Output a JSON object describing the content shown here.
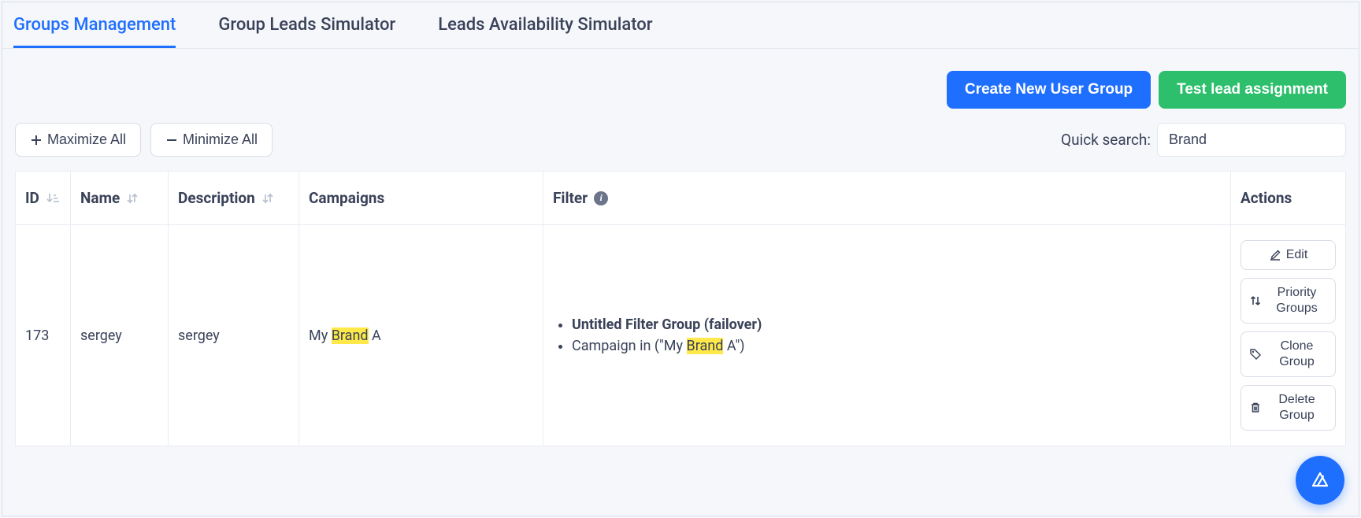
{
  "tabs": [
    {
      "label": "Groups Management",
      "active": true
    },
    {
      "label": "Group Leads Simulator",
      "active": false
    },
    {
      "label": "Leads Availability Simulator",
      "active": false
    }
  ],
  "buttons": {
    "create_group": "Create New User Group",
    "test_assignment": "Test lead assignment",
    "maximize_all": "Maximize All",
    "minimize_all": "Minimize All"
  },
  "search": {
    "label": "Quick search:",
    "value": "Brand"
  },
  "table": {
    "columns": {
      "id": "ID",
      "name": "Name",
      "description": "Description",
      "campaigns": "Campaigns",
      "filter": "Filter",
      "actions": "Actions"
    },
    "rows": [
      {
        "id": "173",
        "name": "sergey",
        "description": "sergey",
        "campaign_prefix": "My ",
        "campaign_highlight": "Brand",
        "campaign_suffix": " A",
        "filter_title": "Untitled Filter Group (failover)",
        "filter_line_prefix": "Campaign in (\"My ",
        "filter_line_highlight": "Brand",
        "filter_line_suffix": " A\")"
      }
    ]
  },
  "actions": {
    "edit": "Edit",
    "priority": "Priority Groups",
    "clone": "Clone Group",
    "delete": "Delete Group"
  }
}
